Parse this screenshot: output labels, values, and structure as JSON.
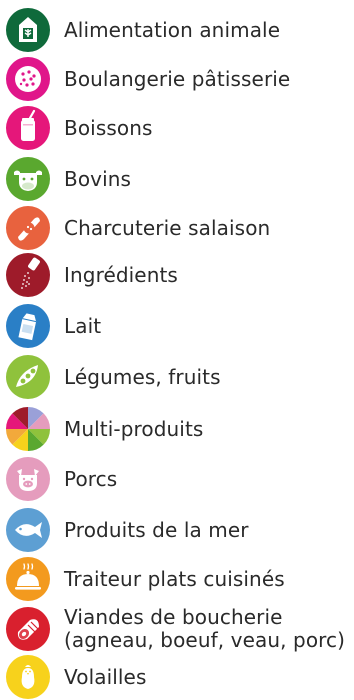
{
  "legend": {
    "items": [
      {
        "label": "Alimentation animale",
        "icon": "feed-silo-icon",
        "color": "#0f6a3b"
      },
      {
        "label": "Boulangerie pâtisserie",
        "icon": "cookie-icon",
        "color": "#e0168a"
      },
      {
        "label": "Boissons",
        "icon": "drink-can-icon",
        "color": "#e5177a"
      },
      {
        "label": "Bovins",
        "icon": "cow-icon",
        "color": "#5aa82f"
      },
      {
        "label": "Charcuterie salaison",
        "icon": "sausage-icon",
        "color": "#e8623e"
      },
      {
        "label": "Ingrédients",
        "icon": "salt-shaker-icon",
        "color": "#9e1b2a"
      },
      {
        "label": "Lait",
        "icon": "milk-carton-icon",
        "color": "#2a7fc6"
      },
      {
        "label": "Légumes, fruits",
        "icon": "peas-pod-icon",
        "color": "#8fc23c"
      },
      {
        "label": "Multi-produits",
        "icon": "multi-pie-icon",
        "color": "#f2a93b"
      },
      {
        "label": "Porcs",
        "icon": "pig-icon",
        "color": "#e59cbd"
      },
      {
        "label": "Produits de la mer",
        "icon": "fish-icon",
        "color": "#5d9fd3"
      },
      {
        "label": "Traiteur plats cuisinés",
        "icon": "cloche-icon",
        "color": "#f39a1e"
      },
      {
        "label_line1": "Viandes de boucherie",
        "label_line2": "(agneau, boeuf, veau, porc)",
        "icon": "meat-roast-icon",
        "color": "#d9202e"
      },
      {
        "label": "Volailles",
        "icon": "chicken-icon",
        "color": "#f7d21c"
      }
    ]
  }
}
